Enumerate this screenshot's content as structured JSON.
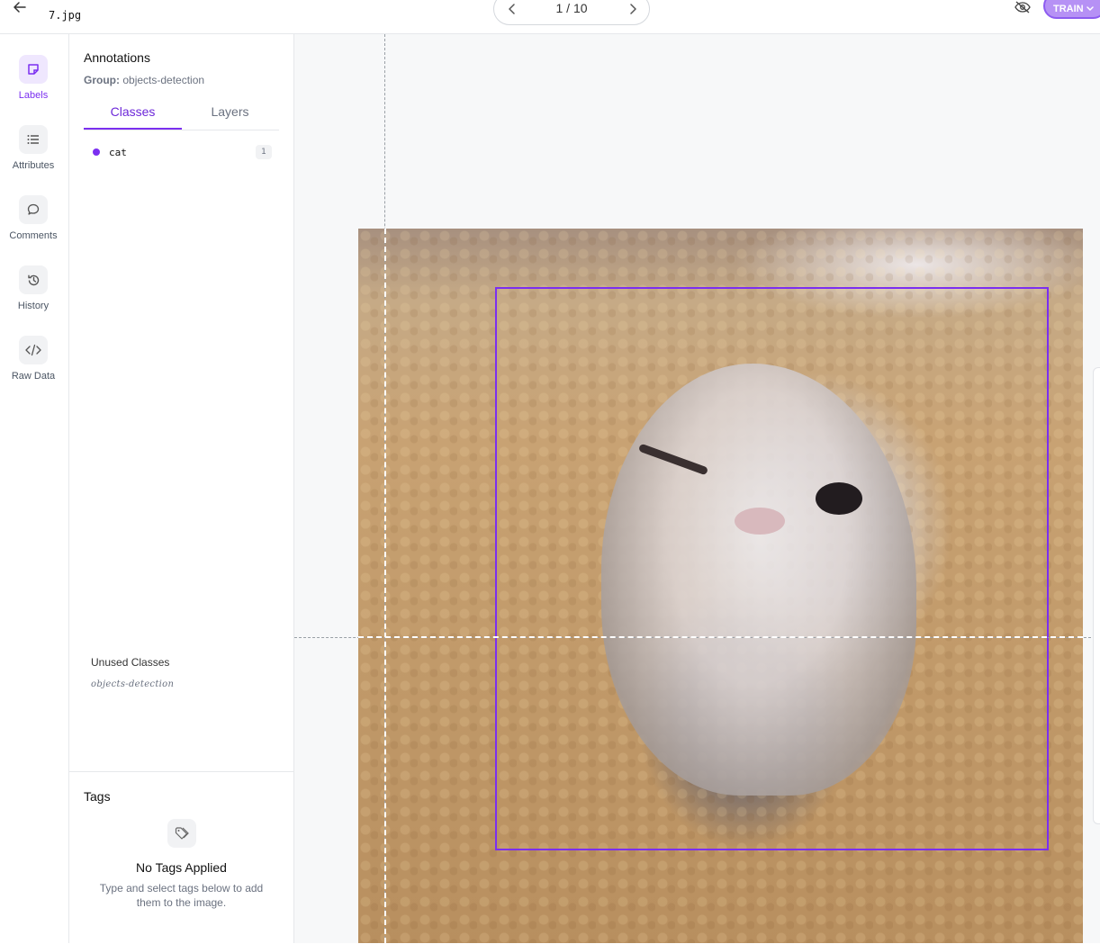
{
  "header": {
    "filename": "7.jpg",
    "pager": "1 / 10",
    "train_label": "TRAIN",
    "icons": {
      "back": "arrow-left-icon",
      "prev": "chevron-left-icon",
      "next": "chevron-right-icon",
      "visibility": "eye-off-icon",
      "train_dropdown": "chevron-down-icon"
    }
  },
  "rail": {
    "items": [
      {
        "label": "Labels",
        "icon": "label-icon",
        "active": true
      },
      {
        "label": "Attributes",
        "icon": "list-icon"
      },
      {
        "label": "Comments",
        "icon": "comment-icon"
      },
      {
        "label": "History",
        "icon": "history-icon"
      },
      {
        "label": "Raw Data",
        "icon": "code-icon"
      }
    ]
  },
  "panel": {
    "title": "Annotations",
    "group_key": "Group:",
    "group_value": "objects-detection",
    "tabs": [
      {
        "label": "Classes",
        "active": true
      },
      {
        "label": "Layers"
      }
    ],
    "classes": [
      {
        "name": "cat",
        "count": "1",
        "color": "#7b2ff0"
      }
    ],
    "unused_title": "Unused Classes",
    "unused_items": [
      "objects-detection"
    ]
  },
  "tags": {
    "title": "Tags",
    "empty_title": "No Tags Applied",
    "empty_subtitle": "Type and select tags below to add them to the image.",
    "icon": "tag-icon"
  },
  "canvas": {
    "image": "cat photo",
    "annotation_class": "cat",
    "accent_color": "#7b2ff0"
  }
}
